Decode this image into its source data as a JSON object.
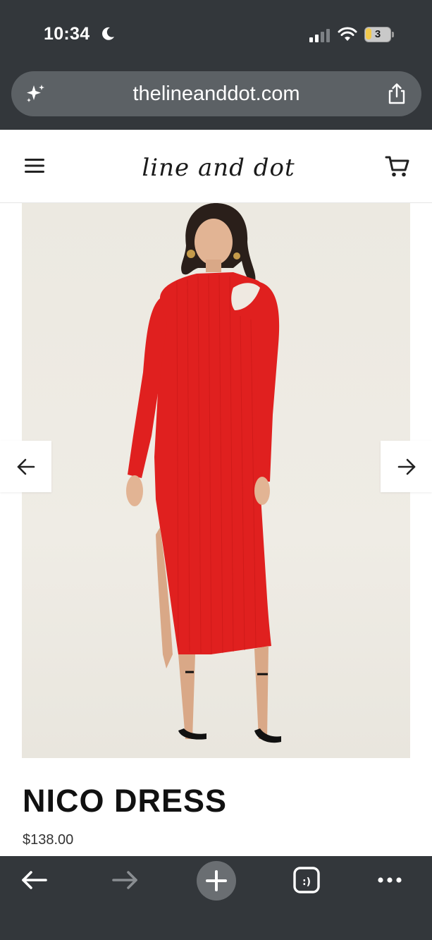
{
  "status_bar": {
    "time": "10:34",
    "battery_level": "3"
  },
  "browser": {
    "url": "thelineanddot.com"
  },
  "site": {
    "logo_text": "line and dot"
  },
  "product": {
    "name": "NICO DRESS",
    "price": "$138.00",
    "dress_color": "#e0201f"
  },
  "icons": {
    "menu": "hamburger-icon",
    "cart": "cart-icon",
    "prev": "arrow-left-icon",
    "next": "arrow-right-icon",
    "back": "back-icon",
    "forward": "forward-icon",
    "new_tab": "plus-icon",
    "tabs": "tabs-icon",
    "more": "more-icon"
  }
}
